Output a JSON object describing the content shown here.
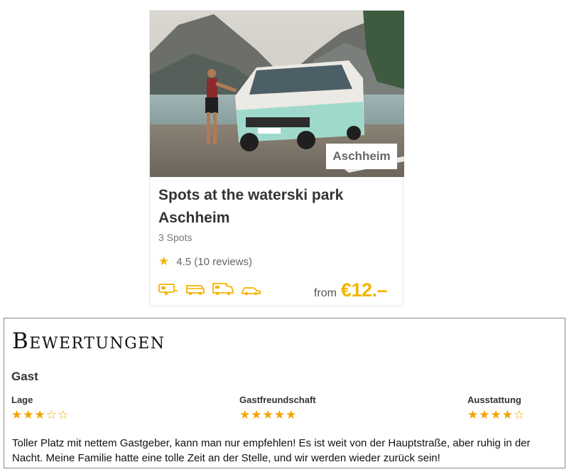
{
  "listing": {
    "location": "Aschheim",
    "title": "Spots at the waterski park Aschheim",
    "spots": "3 Spots",
    "rating": "4.5 (10 reviews)",
    "price_prefix": "from",
    "price": "€12.–",
    "vehicle_icons": [
      "caravan-icon",
      "van-icon",
      "motorhome-icon",
      "car-icon"
    ],
    "accent_color": "#f5b400"
  },
  "reviews": {
    "heading": "Bewertungen",
    "reviewer": "Gast",
    "criteria": [
      {
        "label": "Lage",
        "rating": 3,
        "max": 5
      },
      {
        "label": "Gastfreundschaft",
        "rating": 5,
        "max": 5
      },
      {
        "label": "Ausstattung",
        "rating": 4,
        "max": 5
      }
    ],
    "text": "Toller Platz mit nettem Gastgeber, kann man nur empfehlen! Es ist weit von der Hauptstraße, aber ruhig in der Nacht. Meine Familie hatte eine tolle Zeit an der Stelle, und wir werden wieder zurück sein!"
  }
}
